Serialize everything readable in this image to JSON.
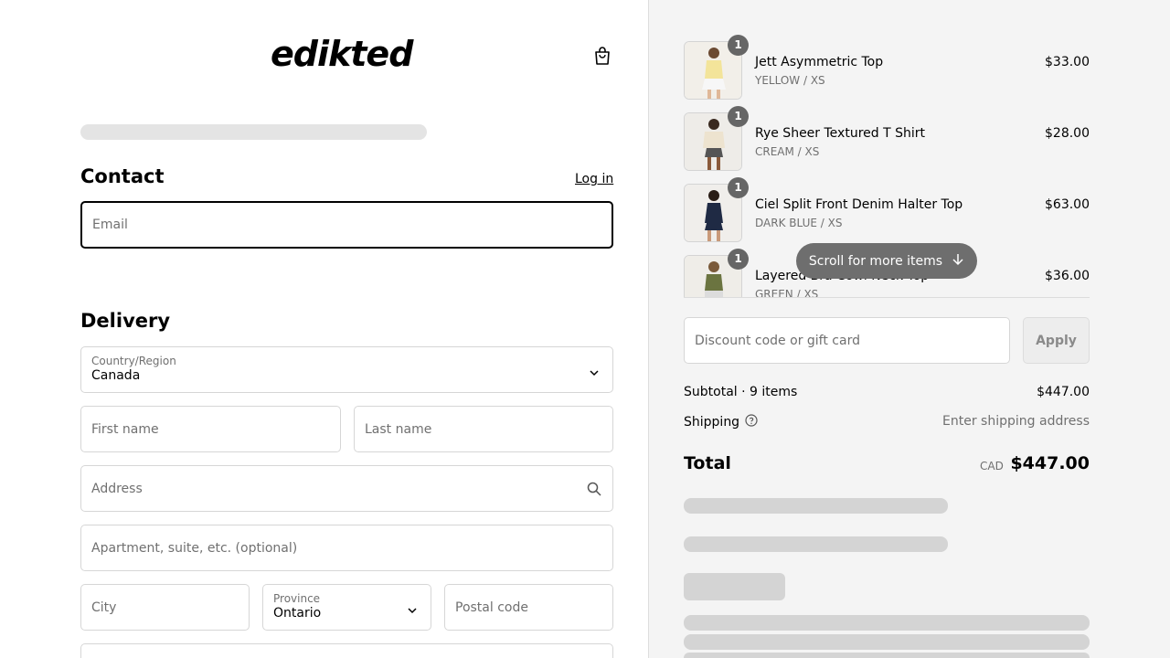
{
  "brand": {
    "name": "edikted"
  },
  "contact": {
    "title": "Contact",
    "login_label": "Log in",
    "email_placeholder": "Email"
  },
  "delivery": {
    "title": "Delivery",
    "country_label": "Country/Region",
    "country_value": "Canada",
    "first_name_placeholder": "First name",
    "last_name_placeholder": "Last name",
    "address_placeholder": "Address",
    "apartment_placeholder": "Apartment, suite, etc. (optional)",
    "city_placeholder": "City",
    "province_label": "Province",
    "province_value": "Ontario",
    "postal_placeholder": "Postal code"
  },
  "cart": {
    "items": [
      {
        "name": "Jett Asymmetric Top",
        "variant": "YELLOW / XS",
        "price": "$33.00",
        "qty": "1"
      },
      {
        "name": "Rye Sheer Textured T Shirt",
        "variant": "CREAM / XS",
        "price": "$28.00",
        "qty": "1"
      },
      {
        "name": "Ciel Split Front Denim Halter Top",
        "variant": "DARK BLUE / XS",
        "price": "$63.00",
        "qty": "1"
      },
      {
        "name": "Layered Bra Cowl Neck Top",
        "variant": "GREEN / XS",
        "price": "$36.00",
        "qty": "1"
      }
    ],
    "scroll_hint": "Scroll for more items"
  },
  "discount": {
    "placeholder": "Discount code or gift card",
    "apply_label": "Apply"
  },
  "summary": {
    "subtotal_label": "Subtotal · 9 items",
    "subtotal_value": "$447.00",
    "shipping_label": "Shipping",
    "shipping_value": "Enter shipping address",
    "total_label": "Total",
    "currency": "CAD",
    "total_value": "$447.00"
  }
}
